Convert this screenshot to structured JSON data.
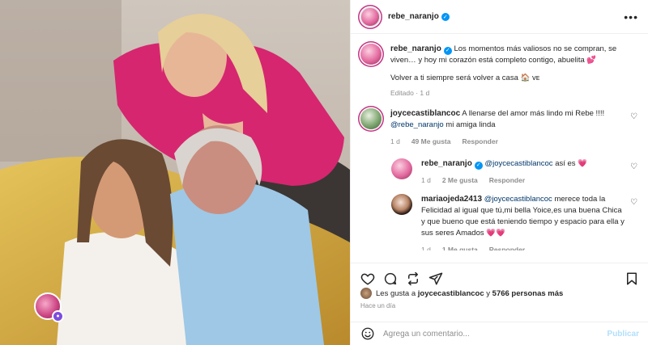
{
  "post": {
    "username": "rebe_naranjo",
    "caption_line1": "Los momentos más valiosos no se compran, se viven… y hoy mi corazón está completo contigo, abuelita 💕",
    "caption_line2": "Volver a ti siempre será volver a casa 🏠 ᴠᴇ",
    "caption_meta": "Editado · 1 d"
  },
  "comments": [
    {
      "username": "joycecastiblancoc",
      "text": "A llenarse del amor más lindo mi Rebe !!!!",
      "mention": "@rebe_naranjo",
      "text2": " mi amiga linda",
      "time": "1 d",
      "likes": "49 Me gusta",
      "reply_label": "Responder"
    }
  ],
  "replies": [
    {
      "username": "rebe_naranjo",
      "mention": "@joycecastiblancoc",
      "text": " así es ",
      "emoji": "💗",
      "time": "1 d",
      "likes": "2 Me gusta",
      "reply_label": "Responder"
    },
    {
      "username": "mariaojeda2413",
      "mention": "@joycecastiblancoc",
      "text": " merece toda la Felicidad al igual que tú,mi bella Yoice,es una buena Chica y que bueno que está teniendo tiempo y espacio para ella y sus seres Amados ",
      "emoji": "💗💗",
      "time": "1 d",
      "likes": "1 Me gusta",
      "reply_label": "Responder"
    }
  ],
  "likes_line": {
    "prefix": "Les gusta a ",
    "user": "joycecastiblancoc",
    "middle": " y ",
    "count": "5766 personas más"
  },
  "posted_ago": "Hace un día",
  "composer": {
    "placeholder": "Agrega un comentario...",
    "publish": "Publicar"
  },
  "icons": {
    "more": "more-options-icon",
    "like": "heart-icon",
    "comment": "comment-icon",
    "share": "repost-icon",
    "send": "send-icon",
    "save": "bookmark-icon",
    "emoji": "emoji-icon"
  },
  "colors": {
    "verified": "#0095f6",
    "mention": "#00376b",
    "muted": "#8e8e8e",
    "publish": "#b2dffc",
    "sweater": "#d6266f"
  }
}
